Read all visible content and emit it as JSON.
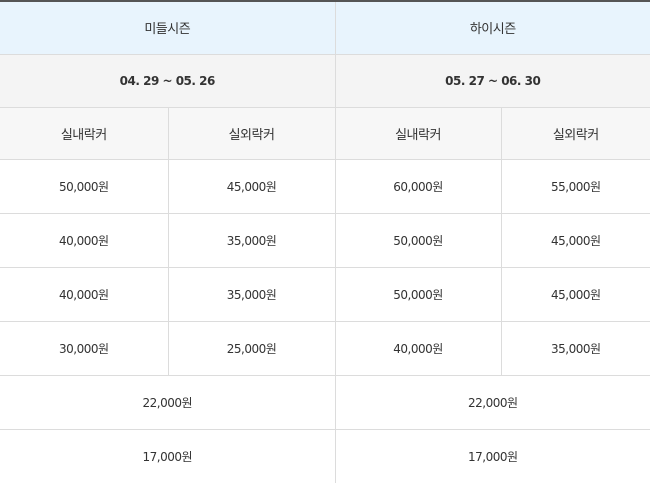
{
  "seasons": [
    {
      "name": "미들시즌",
      "dates": "04. 29 ~ 05. 26"
    },
    {
      "name": "하이시즌",
      "dates": "05. 27 ~ 06. 30"
    }
  ],
  "locker_types": [
    "실내락커",
    "실외락커",
    "실내락커",
    "실외락커"
  ],
  "price_rows": [
    [
      "50,000원",
      "45,000원",
      "60,000원",
      "55,000원"
    ],
    [
      "40,000원",
      "35,000원",
      "50,000원",
      "45,000원"
    ],
    [
      "40,000원",
      "35,000원",
      "50,000원",
      "45,000원"
    ],
    [
      "30,000원",
      "25,000원",
      "40,000원",
      "35,000원"
    ]
  ],
  "merged_rows": [
    [
      "22,000원",
      "22,000원"
    ],
    [
      "17,000원",
      "17,000원"
    ]
  ],
  "colors": {
    "season_header_bg": "#e8f4fd",
    "date_row_bg": "#f4f4f4",
    "border": "#dcdcdc"
  }
}
